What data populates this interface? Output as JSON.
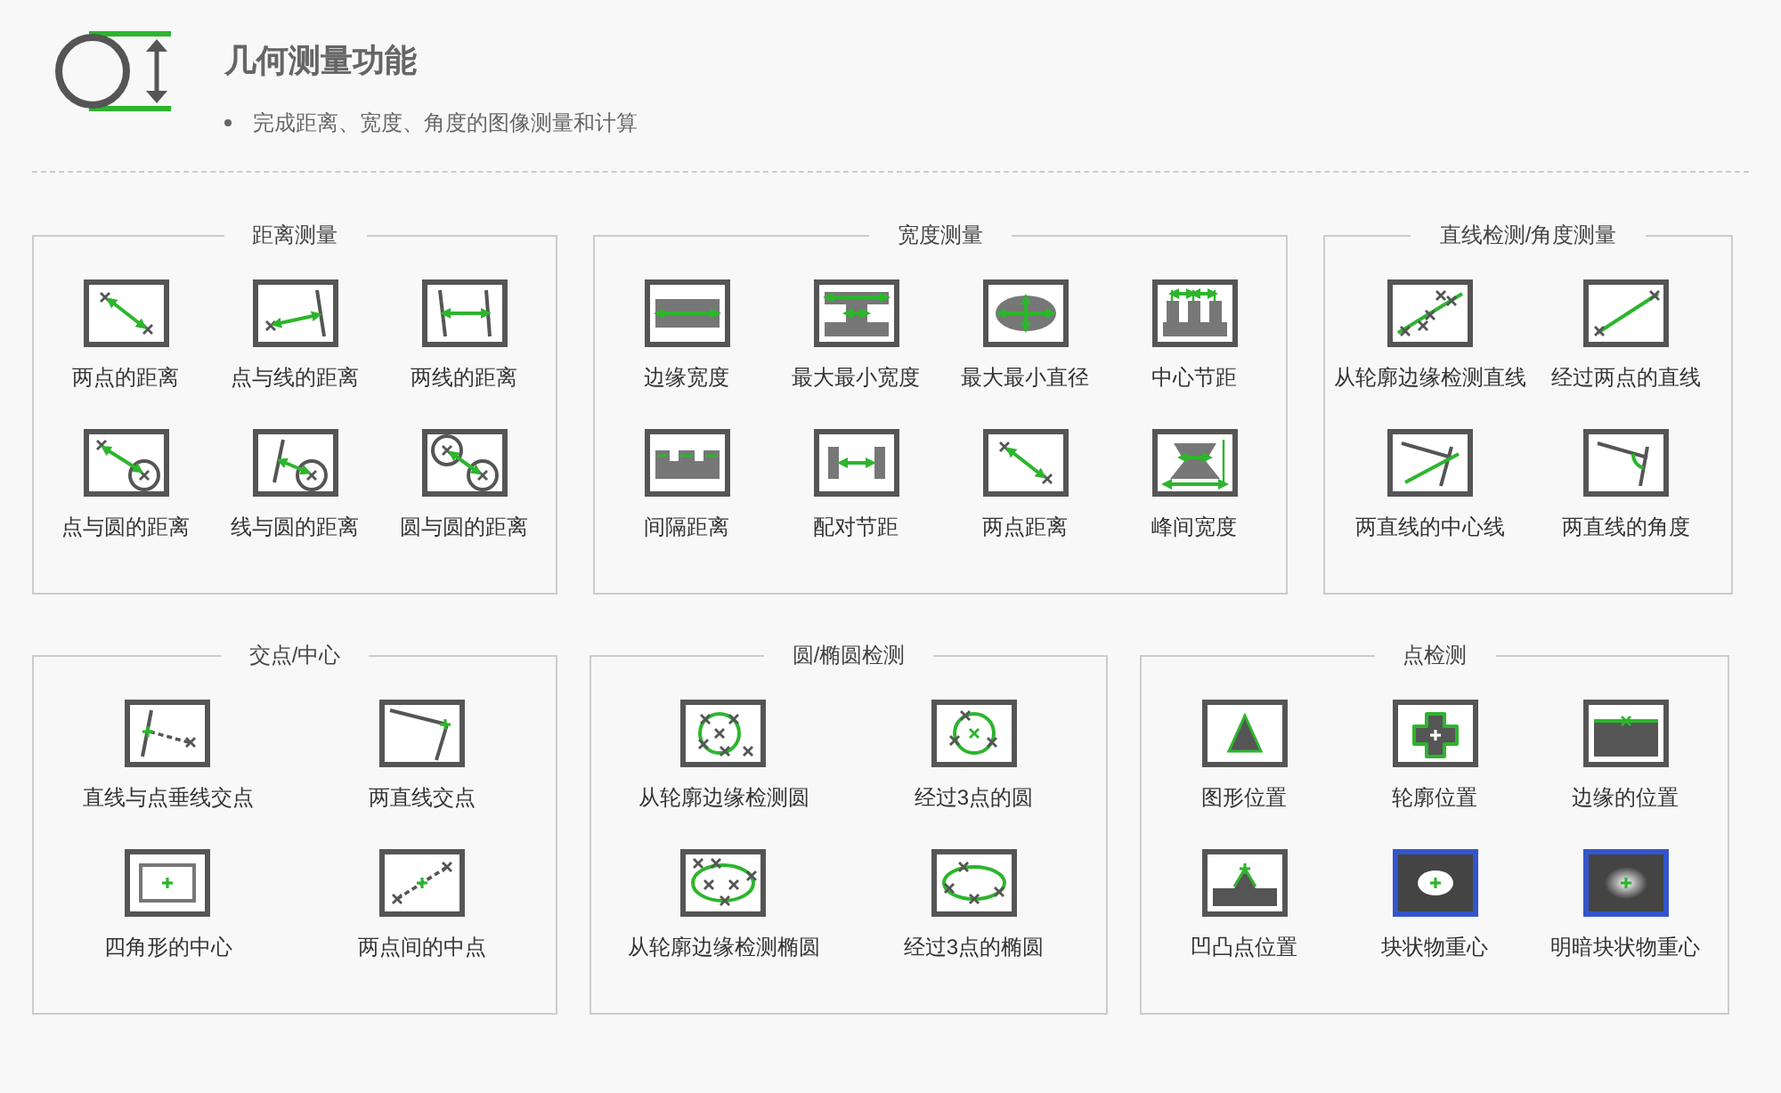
{
  "header": {
    "title": "几何测量功能",
    "bullets": [
      "完成距离、宽度、角度的图像测量和计算"
    ]
  },
  "groups": [
    {
      "title": "距离测量",
      "items": [
        "两点的距离",
        "点与线的距离",
        "两线的距离",
        "点与圆的距离",
        "线与圆的距离",
        "圆与圆的距离"
      ]
    },
    {
      "title": "宽度测量",
      "items": [
        "边缘宽度",
        "最大最小宽度",
        "最大最小直径",
        "中心节距",
        "间隔距离",
        "配对节距",
        "两点距离",
        "峰间宽度"
      ]
    },
    {
      "title": "直线检测/角度测量",
      "items": [
        "从轮廓边缘检测直线",
        "经过两点的直线",
        "两直线的中心线",
        "两直线的角度"
      ]
    },
    {
      "title": "交点/中心",
      "items": [
        "直线与点垂线交点",
        "两直线交点",
        "四角形的中心",
        "两点间的中点"
      ]
    },
    {
      "title": "圆/椭圆检测",
      "items": [
        "从轮廓边缘检测圆",
        "经过3点的圆",
        "从轮廓边缘检测椭圆",
        "经过3点的椭圆"
      ]
    },
    {
      "title": "点检测",
      "items": [
        "图形位置",
        "轮廓位置",
        "边缘的位置",
        "凹凸点位置",
        "块状物重心",
        "明暗块状物重心"
      ]
    }
  ]
}
